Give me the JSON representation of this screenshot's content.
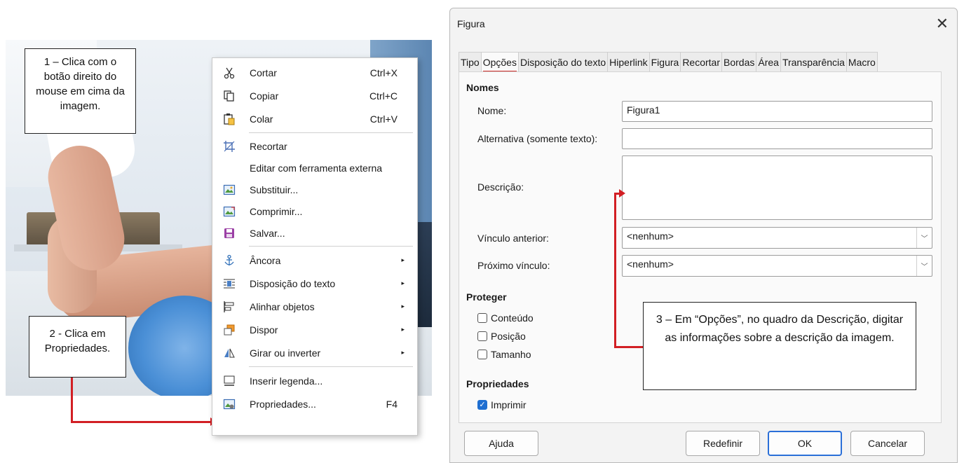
{
  "callouts": {
    "step1": "1 – Clica com o botão direito do mouse em cima da imagem.",
    "step2": "2 - Clica em Propriedades.",
    "step3": "3 – Em “Opções”, no quadro da Descrição, digitar as informações sobre a descrição da imagem."
  },
  "context_menu": {
    "items": [
      {
        "label": "Cortar",
        "shortcut": "Ctrl+X",
        "icon": "scissors-icon"
      },
      {
        "label": "Copiar",
        "shortcut": "Ctrl+C",
        "icon": "copy-icon"
      },
      {
        "label": "Colar",
        "shortcut": "Ctrl+V",
        "icon": "paste-icon"
      },
      {
        "label": "Recortar",
        "shortcut": "",
        "icon": "crop-icon"
      },
      {
        "label": "Editar com ferramenta externa",
        "shortcut": "",
        "icon": ""
      },
      {
        "label": "Substituir...",
        "shortcut": "",
        "icon": "replace-image-icon"
      },
      {
        "label": "Comprimir...",
        "shortcut": "",
        "icon": "compress-image-icon"
      },
      {
        "label": "Salvar...",
        "shortcut": "",
        "icon": "save-icon"
      },
      {
        "label": "Âncora",
        "shortcut": "▸",
        "icon": "anchor-icon"
      },
      {
        "label": "Disposição do texto",
        "shortcut": "▸",
        "icon": "text-wrap-icon"
      },
      {
        "label": "Alinhar objetos",
        "shortcut": "▸",
        "icon": "align-objects-icon"
      },
      {
        "label": "Dispor",
        "shortcut": "▸",
        "icon": "arrange-icon"
      },
      {
        "label": "Girar ou inverter",
        "shortcut": "▸",
        "icon": "rotate-flip-icon"
      },
      {
        "label": "Inserir legenda...",
        "shortcut": "",
        "icon": "caption-icon"
      },
      {
        "label": "Propriedades...",
        "shortcut": "F4",
        "icon": "properties-icon"
      }
    ]
  },
  "dialog": {
    "title": "Figura",
    "close": "✕",
    "tabs": [
      "Tipo",
      "Opções",
      "Disposição do texto",
      "Hiperlink",
      "Figura",
      "Recortar",
      "Bordas",
      "Área",
      "Transparência",
      "Macro"
    ],
    "active_tab": "Opções",
    "nomes": {
      "heading": "Nomes",
      "nome_label": "Nome:",
      "nome_value": "Figura1",
      "alt_label": "Alternativa (somente texto):",
      "alt_value": "",
      "desc_label": "Descrição:",
      "desc_value": "",
      "prev_label": "Vínculo anterior:",
      "prev_value": "<nenhum>",
      "next_label": "Próximo vínculo:",
      "next_value": "<nenhum>"
    },
    "proteger": {
      "heading": "Proteger",
      "conteudo": "Conteúdo",
      "posicao": "Posição",
      "tamanho": "Tamanho"
    },
    "propriedades": {
      "heading": "Propriedades",
      "imprimir": "Imprimir"
    },
    "buttons": {
      "ajuda": "Ajuda",
      "redefinir": "Redefinir",
      "ok": "OK",
      "cancelar": "Cancelar"
    }
  }
}
